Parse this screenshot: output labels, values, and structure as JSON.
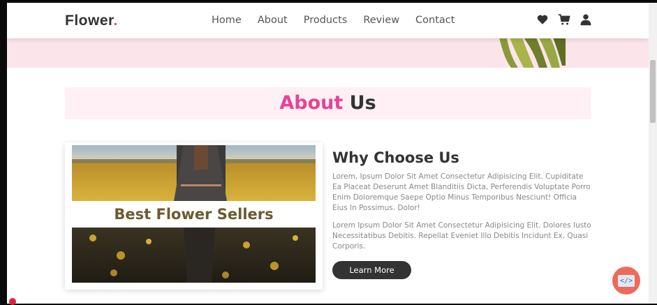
{
  "brand": {
    "name": "Flower",
    "dot": "."
  },
  "nav": {
    "items": [
      "Home",
      "About",
      "Products",
      "Review",
      "Contact"
    ]
  },
  "header_icons": [
    "heart-icon",
    "cart-icon",
    "user-icon"
  ],
  "about": {
    "title_accent": "About",
    "title_rest": "Us",
    "card_caption": "Best Flower Sellers",
    "heading": "Why Choose Us",
    "para1": "Lorem, Ipsum Dolor Sit Amet Consectetur Adipisicing Elit. Cupiditate Ea Placeat Deserunt Amet Blanditiis Dicta, Perferendis Voluptate Porro Enim Doloremque Saepe Optio Minus Temporibus Nesciunt! Officia Eius In Possimus. Dolor!",
    "para2": "Lorem Ipsum Dolor Sit Amet Consectetur Adipisicing Elit. Dolores Iusto Necessitatibus Debitis. Repellat Eveniet Illo Debitis Incidunt Ex, Quasi Corporis.",
    "button_label": "Learn More"
  },
  "dev_button_icon": "</>",
  "colors": {
    "accent": "#e84393",
    "dark": "#333333",
    "pink_band": "#fff0f5",
    "hero_strip": "#fbe4ea"
  }
}
